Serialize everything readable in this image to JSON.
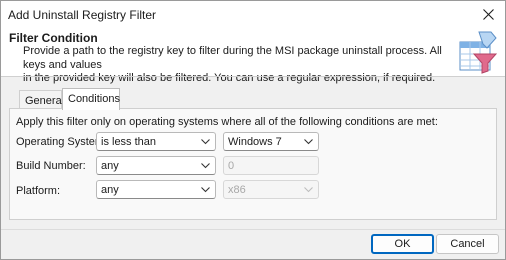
{
  "window": {
    "title": "Add Uninstall Registry Filter"
  },
  "header": {
    "title": "Filter Condition",
    "description": "Provide a path to the registry key to filter during the MSI package uninstall process. All keys and values\nin the provided key will also be filtered. You can use a regular expression, if required."
  },
  "tabs": [
    {
      "label": "General",
      "active": false
    },
    {
      "label": "Conditions",
      "active": true
    }
  ],
  "conditions": {
    "intro": "Apply this filter only on operating systems where all of the following conditions are met:",
    "os": {
      "label": "Operating System:",
      "operator": "is less than",
      "value": "Windows 7"
    },
    "build": {
      "label": "Build Number:",
      "operator": "any",
      "value": "0"
    },
    "platform": {
      "label": "Platform:",
      "operator": "any",
      "value": "x86"
    }
  },
  "buttons": {
    "ok": "OK",
    "cancel": "Cancel"
  },
  "colors": {
    "accent": "#0067c0",
    "icon_blue": "#7fb2e5",
    "icon_pink": "#e06a8c"
  }
}
